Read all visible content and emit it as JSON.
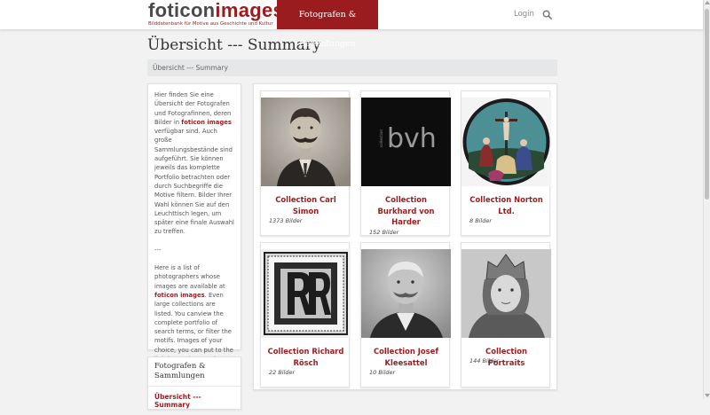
{
  "header": {
    "logo_part1": "foticon",
    "logo_part2": "images",
    "logo_tagline": "Bilddatenbank für Motive aus Geschichte und Kultur",
    "nav_active": "Fotografen & Sammlungen",
    "login": "Login",
    "search_icon": "search-icon"
  },
  "page": {
    "title": "Übersicht --- Summary",
    "breadcrumb": "Übersicht --- Summary"
  },
  "sidebar": {
    "intro_de_1": "Hier finden Sie eine Übersicht der Fotografen und Fotografinnen, deren Bilder in ",
    "intro_de_brand": "foticon images",
    "intro_de_2": " verfügbar sind. Auch große Sammlungsbestände sind aufgeführt. Sie können jeweils das komplette Portfolio betrachten oder durch Suchbegriffe die Motive filtern. Bilder Ihrer Wahl können Sie auf den Leuchttisch legen, um später eine finale Auswahl zu treffen.",
    "separator": "---",
    "intro_en_1": "Here is a list of photographers whose images are available at ",
    "intro_en_brand": "foticon images",
    "intro_en_2": ". Even large collections are listed. You canview the complete portfolio of search terms, or filter the motifs. Images of your choice, you can put to the lightbox to later make a final selection.",
    "nav_title": "Fotografen & Sammlungen",
    "nav_link": "Übersicht --- Summary"
  },
  "collections": [
    {
      "title": "Collection Carl Simon",
      "count": "1373 Bilder"
    },
    {
      "title": "Collection Burkhard von Harder",
      "count": "152 Bilder",
      "logo_text": "bvh",
      "logo_small": "collection"
    },
    {
      "title": "Collection Norton Ltd.",
      "count": "8 Bilder"
    },
    {
      "title": "Collection Richard Rösch",
      "count": "22 Bilder"
    },
    {
      "title": "Collection Josef Kleesattel",
      "count": "10 Bilder"
    },
    {
      "title": "Collection Portraits",
      "count": "144 Bilder"
    }
  ],
  "colors": {
    "brand": "#9b1c1f",
    "breadcrumb_bg": "#e6e7e8",
    "page_bg": "#f2f2f2"
  }
}
